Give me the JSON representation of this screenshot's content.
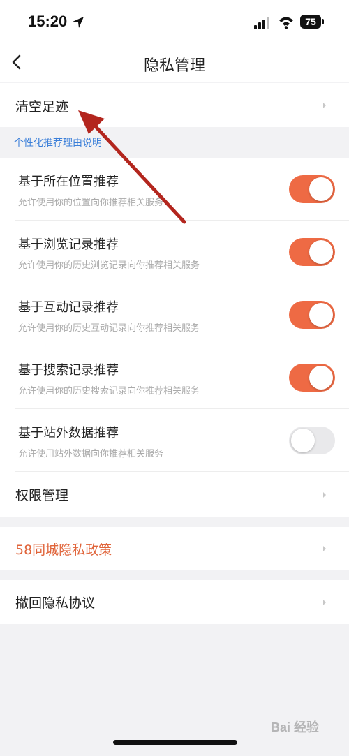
{
  "status_bar": {
    "time": "15:20",
    "battery": "75"
  },
  "nav": {
    "title": "隐私管理"
  },
  "clear_history": {
    "label": "清空足迹"
  },
  "section": {
    "title": "个性化推荐理由说明"
  },
  "toggles": [
    {
      "title": "基于所在位置推荐",
      "subtitle": "允许使用你的位置向你推荐相关服务",
      "on": true
    },
    {
      "title": "基于浏览记录推荐",
      "subtitle": "允许使用你的历史浏览记录向你推荐相关服务",
      "on": true
    },
    {
      "title": "基于互动记录推荐",
      "subtitle": "允许使用你的历史互动记录向你推荐相关服务",
      "on": true
    },
    {
      "title": "基于搜索记录推荐",
      "subtitle": "允许使用你的历史搜索记录向你推荐相关服务",
      "on": true
    },
    {
      "title": "基于站外数据推荐",
      "subtitle": "允许使用站外数据向你推荐相关服务",
      "on": false
    }
  ],
  "permission": {
    "label": "权限管理"
  },
  "privacy_policy": {
    "label": "58同城隐私政策",
    "color": "#e0643a"
  },
  "revoke": {
    "label": "撤回隐私协议"
  },
  "colors": {
    "toggle_on": "#ee6a44",
    "toggle_off": "#e9e9eb",
    "link_blue": "#3b7fd9",
    "annotation_arrow": "#b3261e"
  },
  "watermark": {
    "text": "Bai 经验"
  }
}
